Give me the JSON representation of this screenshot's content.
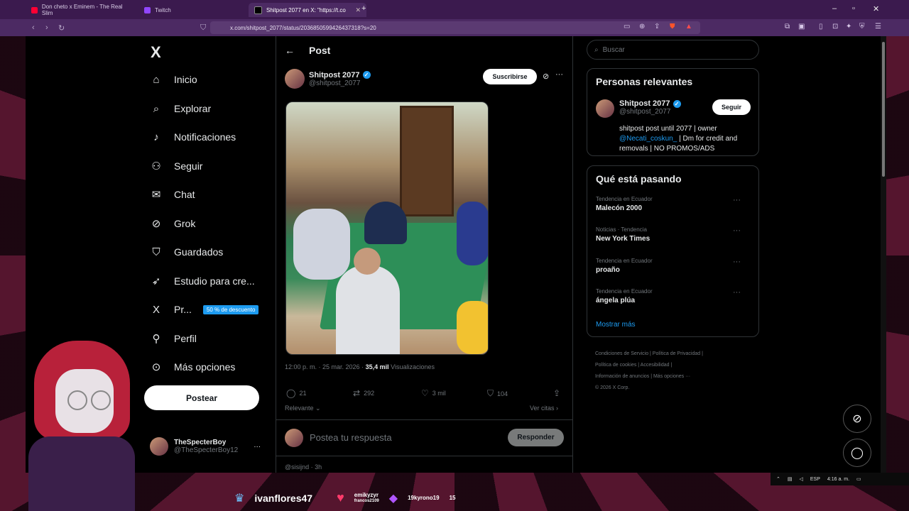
{
  "browser": {
    "tabs": [
      {
        "label": "Don cheto x Eminem - The Real Slim",
        "fav_color": "#ff0033"
      },
      {
        "label": "Twitch",
        "fav_color": "#9146ff"
      },
      {
        "label": "Shitpost 2077 en X: \"https://t.co",
        "fav_color": "#000000"
      }
    ],
    "new_tab": "+",
    "url": "x.com/shitpost_2077/status/2036850599426437318?s=20"
  },
  "nav": {
    "logo": "X",
    "items": [
      {
        "label": "Inicio",
        "icon": "home-icon",
        "glyph": "⌂"
      },
      {
        "label": "Explorar",
        "icon": "search-icon",
        "glyph": "⌕"
      },
      {
        "label": "Notificaciones",
        "icon": "bell-icon",
        "glyph": "♪"
      },
      {
        "label": "Seguir",
        "icon": "person-add-icon",
        "glyph": "⚇"
      },
      {
        "label": "Chat",
        "icon": "mail-icon",
        "glyph": "✉"
      },
      {
        "label": "Grok",
        "icon": "grok-icon",
        "glyph": "⊘"
      },
      {
        "label": "Guardados",
        "icon": "bookmark-icon",
        "glyph": "⛉"
      },
      {
        "label": "Estudio para cre...",
        "icon": "rocket-icon",
        "glyph": "➶"
      },
      {
        "label": "Pr...",
        "icon": "x-premium-icon",
        "glyph": "X"
      },
      {
        "label": "Perfil",
        "icon": "person-icon",
        "glyph": "⚲"
      },
      {
        "label": "Más opciones",
        "icon": "more-circle-icon",
        "glyph": "⊙"
      }
    ],
    "promo_badge": "50 % de descuento",
    "post_button": "Postear",
    "account": {
      "name": "TheSpecterBoy",
      "handle": "@TheSpecterBoy12",
      "more": "···"
    }
  },
  "post": {
    "header_title": "Post",
    "author_name": "Shitpost 2077",
    "author_handle": "@shitpost_2077",
    "subscribe": "Suscribirse",
    "more": "···",
    "time": "12:00 p. m. · 25 mar. 2026 ·",
    "views_count": "35,4 mil",
    "views_label": "Visualizaciones",
    "replies": "21",
    "reposts": "292",
    "likes": "3 mil",
    "bookmarks": "104",
    "sort_label": "Relevante",
    "quotes_label": "Ver citas",
    "reply_placeholder": "Postea tu respuesta",
    "reply_button": "Responder",
    "next_preview": "@sisijnd · 3h"
  },
  "right": {
    "search_placeholder": "Buscar",
    "relevant_title": "Personas relevantes",
    "relevant_person": {
      "name": "Shitpost 2077",
      "handle": "@shitpost_2077",
      "follow": "Seguir",
      "bio_1": "shitpost post until 2077 | owner",
      "bio_link": "@Necati_coskun_",
      "bio_2": "| Dm for credit and removals | NO PROMOS/ADS"
    },
    "trending_title": "Qué está pasando",
    "trends": [
      {
        "category": "Tendencia en Ecuador",
        "topic": "Malecón 2000"
      },
      {
        "category": "Noticias · Tendencia",
        "topic": "New York Times"
      },
      {
        "category": "Tendencia en Ecuador",
        "topic": "proaño"
      },
      {
        "category": "Tendencia en Ecuador",
        "topic": "ángela plúa"
      }
    ],
    "show_more": "Mostrar más",
    "footer": [
      "Condiciones de Servicio | Política de Privacidad |",
      "Política de cookies | Accesibilidad |",
      "Información de anuncios | Más opciones ···",
      "© 2026 X Corp."
    ]
  },
  "stream": {
    "user1": "ivanflores47",
    "user2": "emikyzyr",
    "user2_sub": "francos2109",
    "user3": "19kyrono19",
    "user3_count": "15"
  },
  "taskbar": {
    "lang": "ESP",
    "time": "4:16 a. m."
  }
}
